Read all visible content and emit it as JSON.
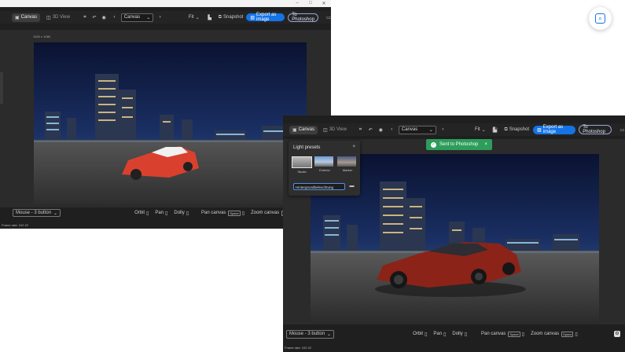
{
  "windows": {
    "back": {
      "titlebar_controls": [
        "–",
        "□",
        "✕"
      ],
      "tabs": [
        {
          "label": "Canvas",
          "active": true
        },
        {
          "label": "3D View",
          "active": false
        }
      ],
      "dropdown_value": "Canvas",
      "fit_label": "Fit",
      "snapshot_label": "Snapshot",
      "export_label": "Export as image",
      "to_photoshop_label": "To Photoshop",
      "canvas_size_label": "1920 x 1080",
      "status": {
        "mouse_mode": "Mouse - 3 button",
        "orbit_label": "Orbit",
        "pan_label": "Pan",
        "dolly_label": "Dolly",
        "pan_canvas_label": "Pan canvas",
        "zoom_canvas_label": "Zoom canvas",
        "key_label": "Space"
      },
      "frame_rate": "Frame rate: 102.22"
    },
    "front": {
      "titlebar_controls": [
        "–",
        "□",
        "✕"
      ],
      "tabs": [
        {
          "label": "Canvas",
          "active": true
        },
        {
          "label": "3D View",
          "active": false
        }
      ],
      "dropdown_value": "Canvas",
      "fit_label": "Fit",
      "snapshot_label": "Snapshot",
      "export_label": "Export as image",
      "to_photoshop_label": "To Photoshop",
      "light_presets": {
        "title": "Light presets",
        "presets": [
          {
            "label": "Studio",
            "selected": true
          },
          {
            "label": "Exterior",
            "selected": false
          },
          {
            "label": "Marker",
            "selected": false
          }
        ],
        "input_value": "Hintergrundbeleuchtung"
      },
      "toast": {
        "message": "Sent to Photoshop"
      },
      "status": {
        "mouse_mode": "Mouse - 3 button",
        "orbit_label": "Orbit",
        "pan_label": "Pan",
        "dolly_label": "Dolly",
        "pan_canvas_label": "Pan canvas",
        "zoom_canvas_label": "Zoom canvas",
        "key_label": "Space"
      },
      "frame_rate": "Frame rate: 102.22"
    }
  },
  "icons": {
    "close": "×",
    "chevron_down": "⌄",
    "chevron_left": "‹",
    "chevron_right": "›",
    "check": "✓",
    "lens": "⌕"
  },
  "colors": {
    "app_bg": "#1f1f1f",
    "accent": "#1473e6",
    "toast": "#2d9d5b",
    "car_red_back": "#d9412e",
    "car_red_front": "#8c2318",
    "sky_top": "#0d1637",
    "road": "#3b3b3b"
  }
}
